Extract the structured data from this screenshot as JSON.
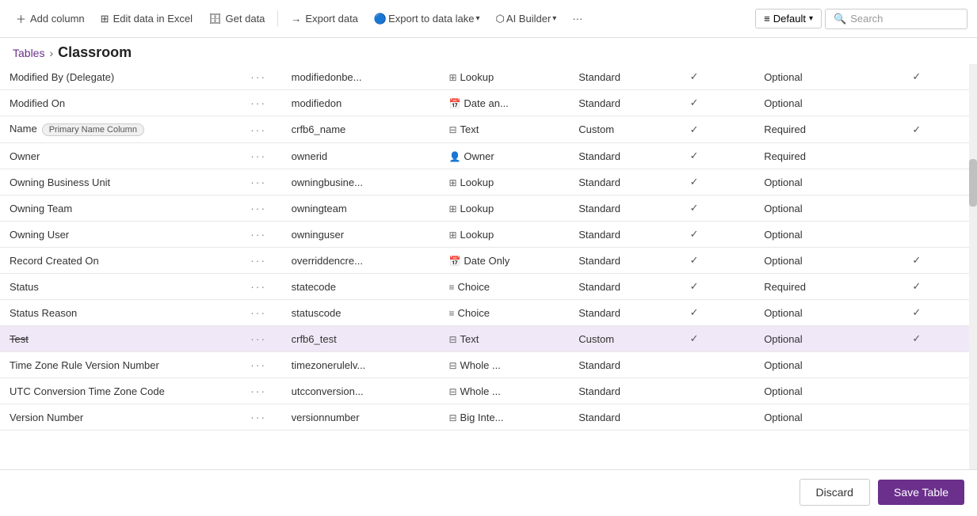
{
  "toolbar": {
    "add_column": "Add column",
    "edit_excel": "Edit data in Excel",
    "get_data": "Get data",
    "export_data": "Export data",
    "export_lake": "Export to data lake",
    "ai_builder": "AI Builder",
    "more": "···",
    "default_label": "Default",
    "search_label": "Search"
  },
  "breadcrumb": {
    "tables": "Tables",
    "separator": "›",
    "current": "Classroom"
  },
  "rows": [
    {
      "name": "Modified By (Delegate)",
      "primary": false,
      "logical": "modifiedonbe...",
      "type_icon": "⊞",
      "type": "Lookup",
      "custom": "Standard",
      "searchable": true,
      "required": "Optional",
      "audited": true
    },
    {
      "name": "Modified On",
      "primary": false,
      "logical": "modifiedon",
      "type_icon": "📅",
      "type": "Date an...",
      "custom": "Standard",
      "searchable": true,
      "required": "Optional",
      "audited": false
    },
    {
      "name": "Name",
      "primary": true,
      "logical": "crfb6_name",
      "type_icon": "⊟",
      "type": "Text",
      "custom": "Custom",
      "searchable": true,
      "required": "Required",
      "audited": true
    },
    {
      "name": "Owner",
      "primary": false,
      "logical": "ownerid",
      "type_icon": "👤",
      "type": "Owner",
      "custom": "Standard",
      "searchable": true,
      "required": "Required",
      "audited": false
    },
    {
      "name": "Owning Business Unit",
      "primary": false,
      "logical": "owningbusine...",
      "type_icon": "⊞",
      "type": "Lookup",
      "custom": "Standard",
      "searchable": true,
      "required": "Optional",
      "audited": false
    },
    {
      "name": "Owning Team",
      "primary": false,
      "logical": "owningteam",
      "type_icon": "⊞",
      "type": "Lookup",
      "custom": "Standard",
      "searchable": true,
      "required": "Optional",
      "audited": false
    },
    {
      "name": "Owning User",
      "primary": false,
      "logical": "owninguser",
      "type_icon": "⊞",
      "type": "Lookup",
      "custom": "Standard",
      "searchable": true,
      "required": "Optional",
      "audited": false
    },
    {
      "name": "Record Created On",
      "primary": false,
      "logical": "overriddencre...",
      "type_icon": "📅",
      "type": "Date Only",
      "custom": "Standard",
      "searchable": true,
      "required": "Optional",
      "audited": true
    },
    {
      "name": "Status",
      "primary": false,
      "logical": "statecode",
      "type_icon": "≡",
      "type": "Choice",
      "custom": "Standard",
      "searchable": true,
      "required": "Required",
      "audited": true
    },
    {
      "name": "Status Reason",
      "primary": false,
      "logical": "statuscode",
      "type_icon": "≡",
      "type": "Choice",
      "custom": "Standard",
      "searchable": true,
      "required": "Optional",
      "audited": true
    },
    {
      "name": "Test",
      "primary": false,
      "logical": "crfb6_test",
      "type_icon": "⊟",
      "type": "Text",
      "custom": "Custom",
      "searchable": true,
      "required": "Optional",
      "audited": true,
      "selected": true,
      "strikethrough": true
    },
    {
      "name": "Time Zone Rule Version Number",
      "primary": false,
      "logical": "timezonerulelv...",
      "type_icon": "⊟",
      "type": "Whole ...",
      "custom": "Standard",
      "searchable": false,
      "required": "Optional",
      "audited": false
    },
    {
      "name": "UTC Conversion Time Zone Code",
      "primary": false,
      "logical": "utcconversion...",
      "type_icon": "⊟",
      "type": "Whole ...",
      "custom": "Standard",
      "searchable": false,
      "required": "Optional",
      "audited": false
    },
    {
      "name": "Version Number",
      "primary": false,
      "logical": "versionnumber",
      "type_icon": "⊟",
      "type": "Big Inte...",
      "custom": "Standard",
      "searchable": false,
      "required": "Optional",
      "audited": false
    }
  ],
  "footer": {
    "discard": "Discard",
    "save": "Save Table"
  },
  "primary_badge": "Primary Name Column"
}
